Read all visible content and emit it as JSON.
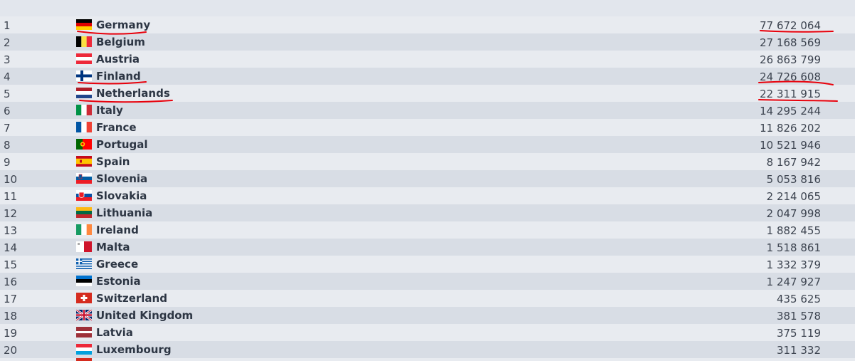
{
  "rows": [
    {
      "rank": "1",
      "country": "Germany",
      "value": "77 672 064",
      "flag": "germany-flag-icon"
    },
    {
      "rank": "2",
      "country": "Belgium",
      "value": "27 168 569",
      "flag": "belgium-flag-icon"
    },
    {
      "rank": "3",
      "country": "Austria",
      "value": "26 863 799",
      "flag": "austria-flag-icon"
    },
    {
      "rank": "4",
      "country": "Finland",
      "value": "24 726 608",
      "flag": "finland-flag-icon"
    },
    {
      "rank": "5",
      "country": "Netherlands",
      "value": "22 311 915",
      "flag": "netherlands-flag-icon"
    },
    {
      "rank": "6",
      "country": "Italy",
      "value": "14 295 244",
      "flag": "italy-flag-icon"
    },
    {
      "rank": "7",
      "country": "France",
      "value": "11 826 202",
      "flag": "france-flag-icon"
    },
    {
      "rank": "8",
      "country": "Portugal",
      "value": "10 521 946",
      "flag": "portugal-flag-icon"
    },
    {
      "rank": "9",
      "country": "Spain",
      "value": "8 167 942",
      "flag": "spain-flag-icon"
    },
    {
      "rank": "10",
      "country": "Slovenia",
      "value": "5 053 816",
      "flag": "slovenia-flag-icon"
    },
    {
      "rank": "11",
      "country": "Slovakia",
      "value": "2 214 065",
      "flag": "slovakia-flag-icon"
    },
    {
      "rank": "12",
      "country": "Lithuania",
      "value": "2 047 998",
      "flag": "lithuania-flag-icon"
    },
    {
      "rank": "13",
      "country": "Ireland",
      "value": "1 882 455",
      "flag": "ireland-flag-icon"
    },
    {
      "rank": "14",
      "country": "Malta",
      "value": "1 518 861",
      "flag": "malta-flag-icon"
    },
    {
      "rank": "15",
      "country": "Greece",
      "value": "1 332 379",
      "flag": "greece-flag-icon"
    },
    {
      "rank": "16",
      "country": "Estonia",
      "value": "1 247 927",
      "flag": "estonia-flag-icon"
    },
    {
      "rank": "17",
      "country": "Switzerland",
      "value": "435 625",
      "flag": "switzerland-flag-icon"
    },
    {
      "rank": "18",
      "country": "United Kingdom",
      "value": "381 578",
      "flag": "united-kingdom-flag-icon"
    },
    {
      "rank": "19",
      "country": "Latvia",
      "value": "375 119",
      "flag": "latvia-flag-icon"
    },
    {
      "rank": "20",
      "country": "Luxembourg",
      "value": "311 332",
      "flag": "luxembourg-flag-icon"
    }
  ],
  "colors": {
    "row_light": "#e8ebf0",
    "row_dark": "#d8dde5",
    "text": "#2d3644",
    "annotation": "#e8000b"
  },
  "annotations": {
    "underlined_countries": [
      "Germany",
      "Finland",
      "Netherlands"
    ],
    "underlined_values": [
      "77 672 064",
      "24 726 608",
      "22 311 915"
    ]
  }
}
